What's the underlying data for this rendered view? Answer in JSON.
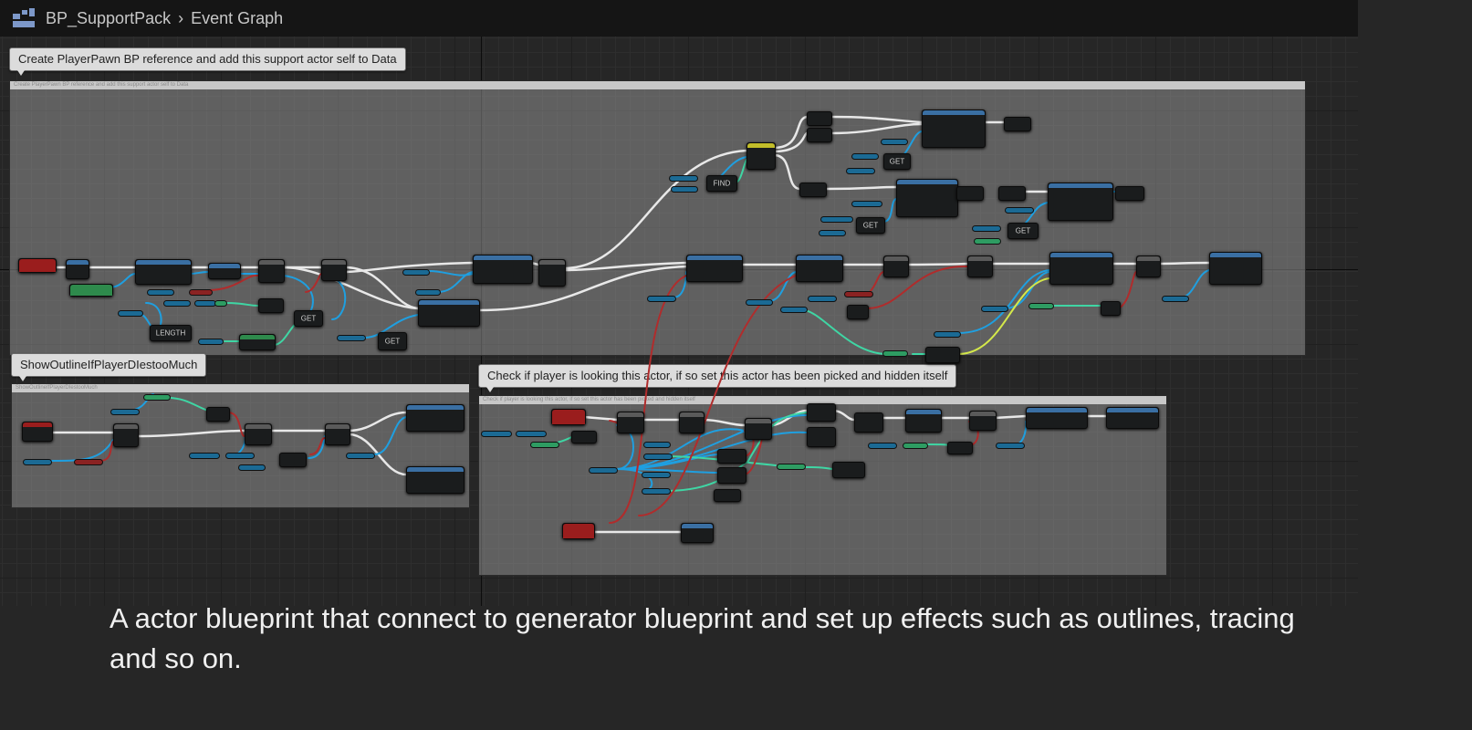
{
  "breadcrumb": {
    "blueprint": "BP_SupportPack",
    "separator": "›",
    "graph": "Event Graph"
  },
  "comments": [
    {
      "bubble": "Create PlayerPawn BP reference and add this support actor self to Data"
    },
    {
      "bubble": "ShowOutlineIfPlayerDIestooMuch"
    },
    {
      "bubble": "Check if player is looking this actor, if so set this actor has been picked and hidden itself"
    }
  ],
  "node_labels": {
    "length": "LENGTH",
    "get": "GET",
    "find": "FIND"
  },
  "caption": "A actor blueprint that connect to generator blueprint and set up effects such as outlines, tracing and so on.",
  "colors": {
    "exec_wire": "#e8e8e8",
    "object_wire": "#1f9fe0",
    "float_wire": "#3fd6a4",
    "bool_wire": "#b02c2c",
    "vector_wire": "#d4e84a",
    "event_header": "#9a1d1d",
    "function_header": "#3a6fa3",
    "pure_header": "#2e8a4c"
  }
}
